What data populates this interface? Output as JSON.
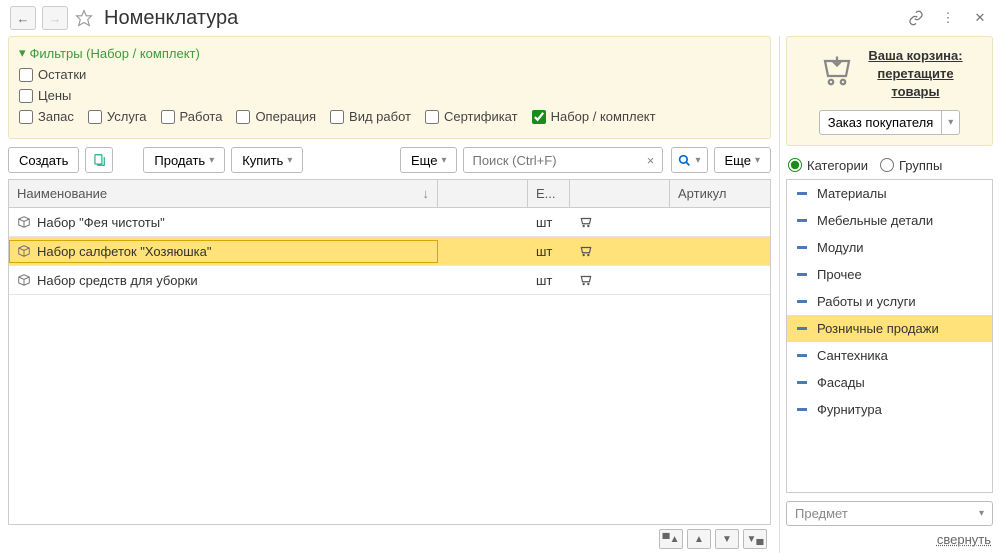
{
  "title": "Номенклатура",
  "filters": {
    "header": "Фильтры (Набор / комплект)",
    "row1": {
      "remains": "Остатки"
    },
    "row2": {
      "prices": "Цены"
    },
    "row3": {
      "stock": "Запас",
      "service": "Услуга",
      "work": "Работа",
      "operation": "Операция",
      "worktype": "Вид работ",
      "certificate": "Сертификат",
      "set": "Набор / комплект"
    }
  },
  "toolbar": {
    "create": "Создать",
    "sell": "Продать",
    "buy": "Купить",
    "more1": "Еще",
    "search_placeholder": "Поиск (Ctrl+F)",
    "more2": "Еще"
  },
  "grid": {
    "headers": {
      "name": "Наименование",
      "unit": "Е...",
      "article": "Артикул"
    },
    "rows": [
      {
        "name": "Набор \"Фея чистоты\"",
        "unit": "шт"
      },
      {
        "name": "Набор салфеток \"Хозяюшка\"",
        "unit": "шт"
      },
      {
        "name": "Набор средств для уборки",
        "unit": "шт"
      }
    ]
  },
  "cart": {
    "line1": "Ваша корзина:",
    "line2": "перетащите",
    "line3": "товары",
    "order": "Заказ покупателя"
  },
  "view": {
    "categories": "Категории",
    "groups": "Группы"
  },
  "categories": [
    "Материалы",
    "Мебельные детали",
    "Модули",
    "Прочее",
    "Работы и услуги",
    "Розничные продажи",
    "Сантехника",
    "Фасады",
    "Фурнитура"
  ],
  "subject": {
    "placeholder": "Предмет"
  },
  "collapse": "свернуть"
}
